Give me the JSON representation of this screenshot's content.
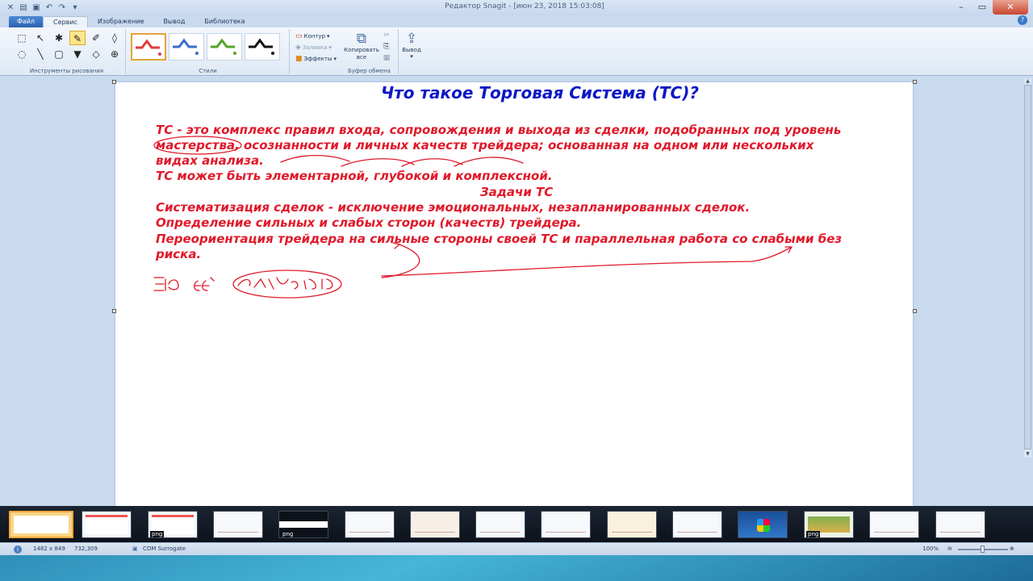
{
  "window": {
    "title": "Редактор Snagit - [июн 23, 2018 15:03:08]",
    "qat": [
      "x-icon",
      "folder-icon",
      "save-icon",
      "undo-icon",
      "redo-icon",
      "dropdown-icon"
    ]
  },
  "tabs": [
    {
      "label": "Файл"
    },
    {
      "label": "Сервис"
    },
    {
      "label": "Изображение"
    },
    {
      "label": "Вывод"
    },
    {
      "label": "Библиотека"
    }
  ],
  "ribbon": {
    "groups": {
      "drawing_tools": "Инструменты рисования",
      "styles": "Стили",
      "clipboard": "Буфер обмена"
    },
    "tools": [
      {
        "name": "selection-tool-icon",
        "glyph": "⬚"
      },
      {
        "name": "arrow-tool-icon",
        "glyph": "↖"
      },
      {
        "name": "stamp-tool-icon",
        "glyph": "✱"
      },
      {
        "name": "pen-tool-icon",
        "glyph": "✎"
      },
      {
        "name": "highlight-tool-icon",
        "glyph": "✐"
      },
      {
        "name": "fill-tool-icon",
        "glyph": "💧"
      },
      {
        "name": "callout-tool-icon",
        "glyph": "◌"
      },
      {
        "name": "line-tool-icon",
        "glyph": "╲"
      },
      {
        "name": "shape-tool-icon",
        "glyph": "▢"
      },
      {
        "name": "fill-bucket-icon",
        "glyph": "▼"
      },
      {
        "name": "eraser-tool-icon",
        "glyph": "◇"
      },
      {
        "name": "step-tool-icon",
        "glyph": "⊕"
      }
    ],
    "styles": [
      "#e23b3b",
      "#3b6ecb",
      "#55a52a",
      "#111111"
    ],
    "format": {
      "outline": "Контур",
      "fill": "Заливка",
      "effects": "Эффекты"
    },
    "copy_all": "Копировать все",
    "output": "Вывод"
  },
  "document": {
    "title": "Что такое Торговая Система (ТС)?",
    "lines": [
      "ТС - это комплекс правил входа, сопровождения и выхода из сделки, подобранных под уровень",
      "мастерства, осознанности и личных качеств трейдера; основанная на одном или нескольких",
      "видах анализа.",
      "ТС может быть элементарной, глубокой и комплексной.",
      "Задачи ТС",
      "Систематизация сделок - исключение эмоциональных, незапланированных сделок.",
      "Определение сильных и слабых сторон (качеств) трейдера.",
      "Переориентация трейдера на сильные стороны своей ТС и параллельная работа со слабыми без",
      "риска."
    ],
    "annotation_color": "#e0192a"
  },
  "filmstrip": {
    "thumbs": [
      {
        "label": "",
        "kind": "slide"
      },
      {
        "label": "",
        "kind": "slide"
      },
      {
        "label": "png",
        "kind": "slide"
      },
      {
        "label": "",
        "kind": "chart"
      },
      {
        "label": "png",
        "kind": "dark"
      },
      {
        "label": "",
        "kind": "chart"
      },
      {
        "label": "",
        "kind": "chart"
      },
      {
        "label": "",
        "kind": "chart"
      },
      {
        "label": "",
        "kind": "chart"
      },
      {
        "label": "",
        "kind": "chart"
      },
      {
        "label": "",
        "kind": "chart"
      },
      {
        "label": "",
        "kind": "windows"
      },
      {
        "label": "png",
        "kind": "app"
      },
      {
        "label": "",
        "kind": "chart"
      },
      {
        "label": "",
        "kind": "chart"
      }
    ]
  },
  "status": {
    "dimensions": "1482 x 849",
    "cursor": "732,309",
    "program": "COM Surrogate",
    "zoom": "100%"
  }
}
